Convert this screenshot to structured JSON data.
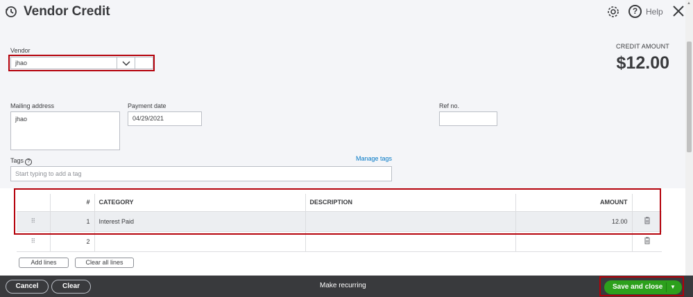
{
  "header": {
    "title": "Vendor Credit",
    "help_label": "Help"
  },
  "vendor": {
    "label": "Vendor",
    "value": "jhao"
  },
  "credit": {
    "label": "CREDIT AMOUNT",
    "amount": "$12.00"
  },
  "mailing": {
    "label": "Mailing address",
    "value": "jhao"
  },
  "payment_date": {
    "label": "Payment date",
    "value": "04/29/2021"
  },
  "ref": {
    "label": "Ref no.",
    "value": ""
  },
  "tags": {
    "label": "Tags",
    "placeholder": "Start typing to add a tag",
    "manage_label": "Manage tags"
  },
  "table": {
    "columns": [
      "#",
      "CATEGORY",
      "DESCRIPTION",
      "AMOUNT"
    ],
    "rows": [
      {
        "num": "1",
        "category": "Interest Paid",
        "description": "",
        "amount": "12.00"
      },
      {
        "num": "2",
        "category": "",
        "description": "",
        "amount": ""
      }
    ]
  },
  "actions": {
    "add_lines": "Add lines",
    "clear_all_lines": "Clear all lines"
  },
  "footer": {
    "cancel": "Cancel",
    "clear": "Clear",
    "make_recurring": "Make recurring",
    "save_and_close": "Save and close"
  },
  "colors": {
    "accent_green": "#2ca01c",
    "highlight_red": "#b4000a",
    "footer_bg": "#393a3d",
    "link_blue": "#0077c5"
  }
}
